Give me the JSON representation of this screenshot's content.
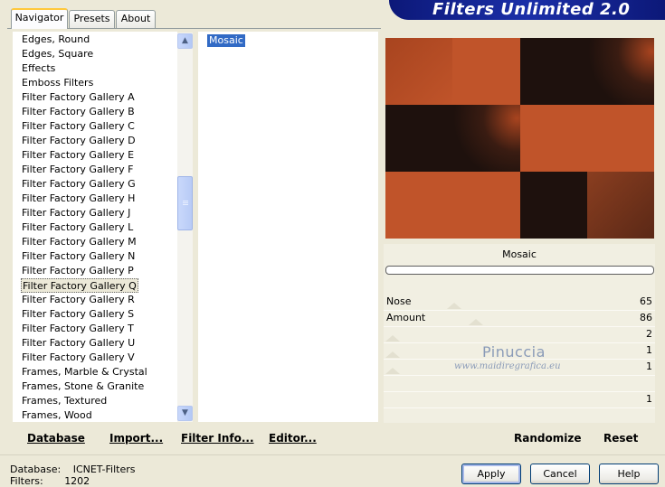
{
  "banner": {
    "title": "Filters Unlimited 2.0"
  },
  "tabs": [
    {
      "label": "Navigator",
      "active": true
    },
    {
      "label": "Presets",
      "active": false
    },
    {
      "label": "About",
      "active": false
    }
  ],
  "categories": [
    "Edges, Round",
    "Edges, Square",
    "Effects",
    "Emboss Filters",
    "Filter Factory Gallery A",
    "Filter Factory Gallery B",
    "Filter Factory Gallery C",
    "Filter Factory Gallery D",
    "Filter Factory Gallery E",
    "Filter Factory Gallery F",
    "Filter Factory Gallery G",
    "Filter Factory Gallery H",
    "Filter Factory Gallery J",
    "Filter Factory Gallery L",
    "Filter Factory Gallery M",
    "Filter Factory Gallery N",
    "Filter Factory Gallery P",
    "Filter Factory Gallery Q",
    "Filter Factory Gallery R",
    "Filter Factory Gallery S",
    "Filter Factory Gallery T",
    "Filter Factory Gallery U",
    "Filter Factory Gallery V",
    "Frames, Marble & Crystal",
    "Frames, Stone & Granite",
    "Frames, Textured",
    "Frames, Wood"
  ],
  "selected_category": "Filter Factory Gallery Q",
  "filters": [
    "Mosaic"
  ],
  "selected_filter": "Mosaic",
  "colors": {
    "orange": "#c0542a",
    "dark": "#1e110d",
    "mid": "#7a3a20"
  },
  "preview": {
    "cells": [
      [
        "orange-dark",
        "orange",
        "dark",
        "dark-glow"
      ],
      [
        "dark",
        "dark-glow",
        "orange",
        "orange"
      ],
      [
        "orange",
        "orange",
        "dark",
        "brown"
      ]
    ]
  },
  "filter_name": "Mosaic",
  "params": [
    {
      "label": "Nose",
      "value": "65"
    },
    {
      "label": "Amount",
      "value": "86"
    },
    {
      "label": "",
      "value": "2"
    },
    {
      "label": "",
      "value": "1"
    },
    {
      "label": "",
      "value": "1"
    },
    {
      "label": "",
      "value": ""
    },
    {
      "label": "",
      "value": "1"
    }
  ],
  "watermark": {
    "name": "Pinuccia",
    "url": "www.maidiregrafica.eu"
  },
  "buttons": {
    "database": "Database",
    "import": "Import...",
    "filter_info": "Filter Info...",
    "editor": "Editor...",
    "randomize": "Randomize",
    "reset": "Reset",
    "apply": "Apply",
    "cancel": "Cancel",
    "help": "Help"
  },
  "status": {
    "database_label": "Database:",
    "database_value": "ICNET-Filters",
    "filters_label": "Filters:",
    "filters_value": "1202"
  }
}
